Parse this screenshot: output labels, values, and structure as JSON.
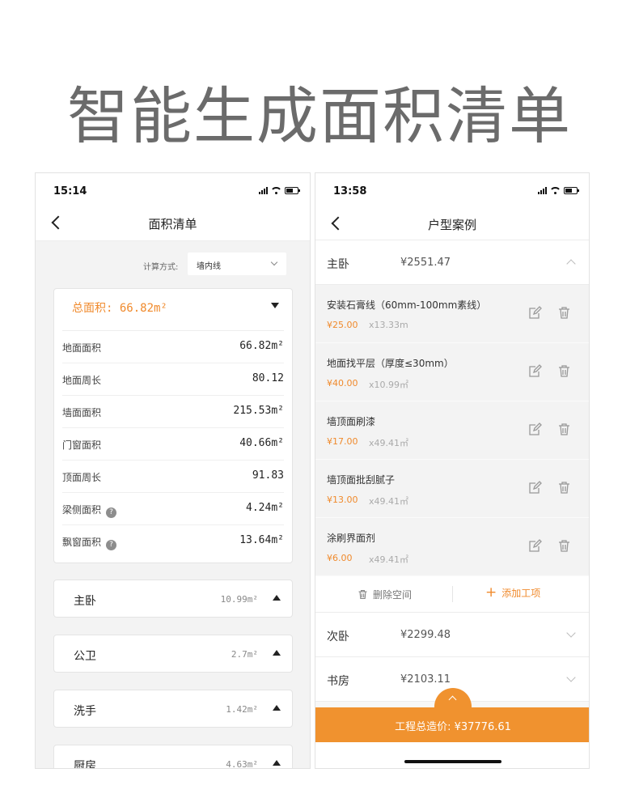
{
  "headline": "智能生成面积清单",
  "left_phone": {
    "time": "15:14",
    "title": "面积清单",
    "calc_label": "计算方式:",
    "calc_value": "墙内线",
    "total": "总面积: 66.82m²",
    "metrics": [
      {
        "label": "地面面积",
        "value": "66.82m²"
      },
      {
        "label": "地面周长",
        "value": "80.12"
      },
      {
        "label": "墙面面积",
        "value": "215.53m²"
      },
      {
        "label": "门窗面积",
        "value": "40.66m²"
      },
      {
        "label": "顶面周长",
        "value": "91.83"
      },
      {
        "label": "梁侧面积",
        "value": "4.24m²"
      },
      {
        "label": "飘窗面积",
        "value": "13.64m²"
      }
    ],
    "rooms": [
      {
        "name": "主卧",
        "area": "10.99m²"
      },
      {
        "name": "公卫",
        "area": "2.7m²"
      },
      {
        "name": "洗手",
        "area": "1.42m²"
      },
      {
        "name": "厨房",
        "area": "4.63m²"
      }
    ]
  },
  "right_phone": {
    "time": "13:58",
    "title": "户型案例",
    "open_section": {
      "name": "主卧",
      "price": "¥2551.47"
    },
    "items": [
      {
        "name": "安装石膏线（60mm-100mm素线）",
        "price": "¥25.00",
        "qty": "x13.33m"
      },
      {
        "name": "地面找平层（厚度≤30mm）",
        "price": "¥40.00",
        "qty": "x10.99㎡"
      },
      {
        "name": "墙顶面刷漆",
        "price": "¥17.00",
        "qty": "x49.41㎡"
      },
      {
        "name": "墙顶面批刮腻子",
        "price": "¥13.00",
        "qty": "x49.41㎡"
      },
      {
        "name": "涂刷界面剂",
        "price": "¥6.00",
        "qty": "x49.41㎡"
      }
    ],
    "delete_space": "删除空间",
    "add_item": "添加工项",
    "closed_sections": [
      {
        "name": "次卧",
        "price": "¥2299.48"
      },
      {
        "name": "书房",
        "price": "¥2103.11"
      }
    ],
    "total_label": "工程总造价:  ¥37776.61"
  },
  "colors": {
    "accent": "#f0922f",
    "accent_text": "#f08a2c"
  }
}
